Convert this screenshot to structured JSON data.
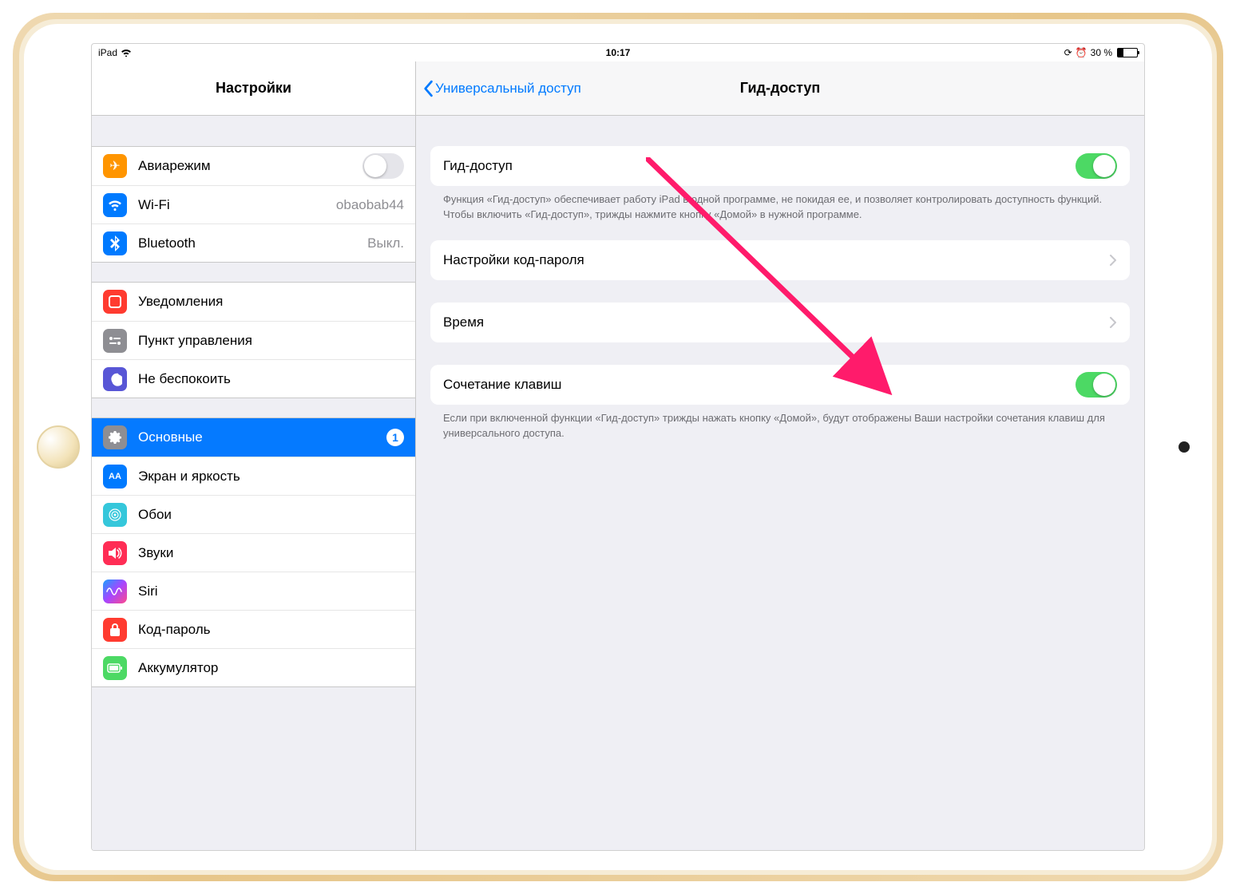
{
  "statusbar": {
    "device": "iPad",
    "time": "10:17",
    "battery_text": "30 %"
  },
  "sidebar": {
    "title": "Настройки",
    "g1": {
      "airplane": "Авиарежим",
      "wifi": "Wi-Fi",
      "wifi_value": "obaobab44",
      "bt": "Bluetooth",
      "bt_value": "Выкл."
    },
    "g2": {
      "notif": "Уведомления",
      "control": "Пункт управления",
      "dnd": "Не беспокоить"
    },
    "g3": {
      "general": "Основные",
      "general_badge": "1",
      "display": "Экран и яркость",
      "wallpaper": "Обои",
      "sounds": "Звуки",
      "siri": "Siri",
      "passcode": "Код-пароль",
      "battery": "Аккумулятор"
    }
  },
  "detail": {
    "back": "Универсальный доступ",
    "title": "Гид-доступ",
    "r1": "Гид-доступ",
    "foot1": "Функция «Гид-доступ» обеспечивает работу iPad в одной программе, не покидая ее, и позволяет контролировать доступность функций. Чтобы включить «Гид-доступ», трижды нажмите кнопку «Домой» в нужной программе.",
    "r2": "Настройки код-пароля",
    "r3": "Время",
    "r4": "Сочетание клавиш",
    "foot2": "Если при включенной функции «Гид-доступ» трижды нажать кнопку «Домой», будут отображены Ваши настройки сочетания клавиш для универсального доступа."
  }
}
